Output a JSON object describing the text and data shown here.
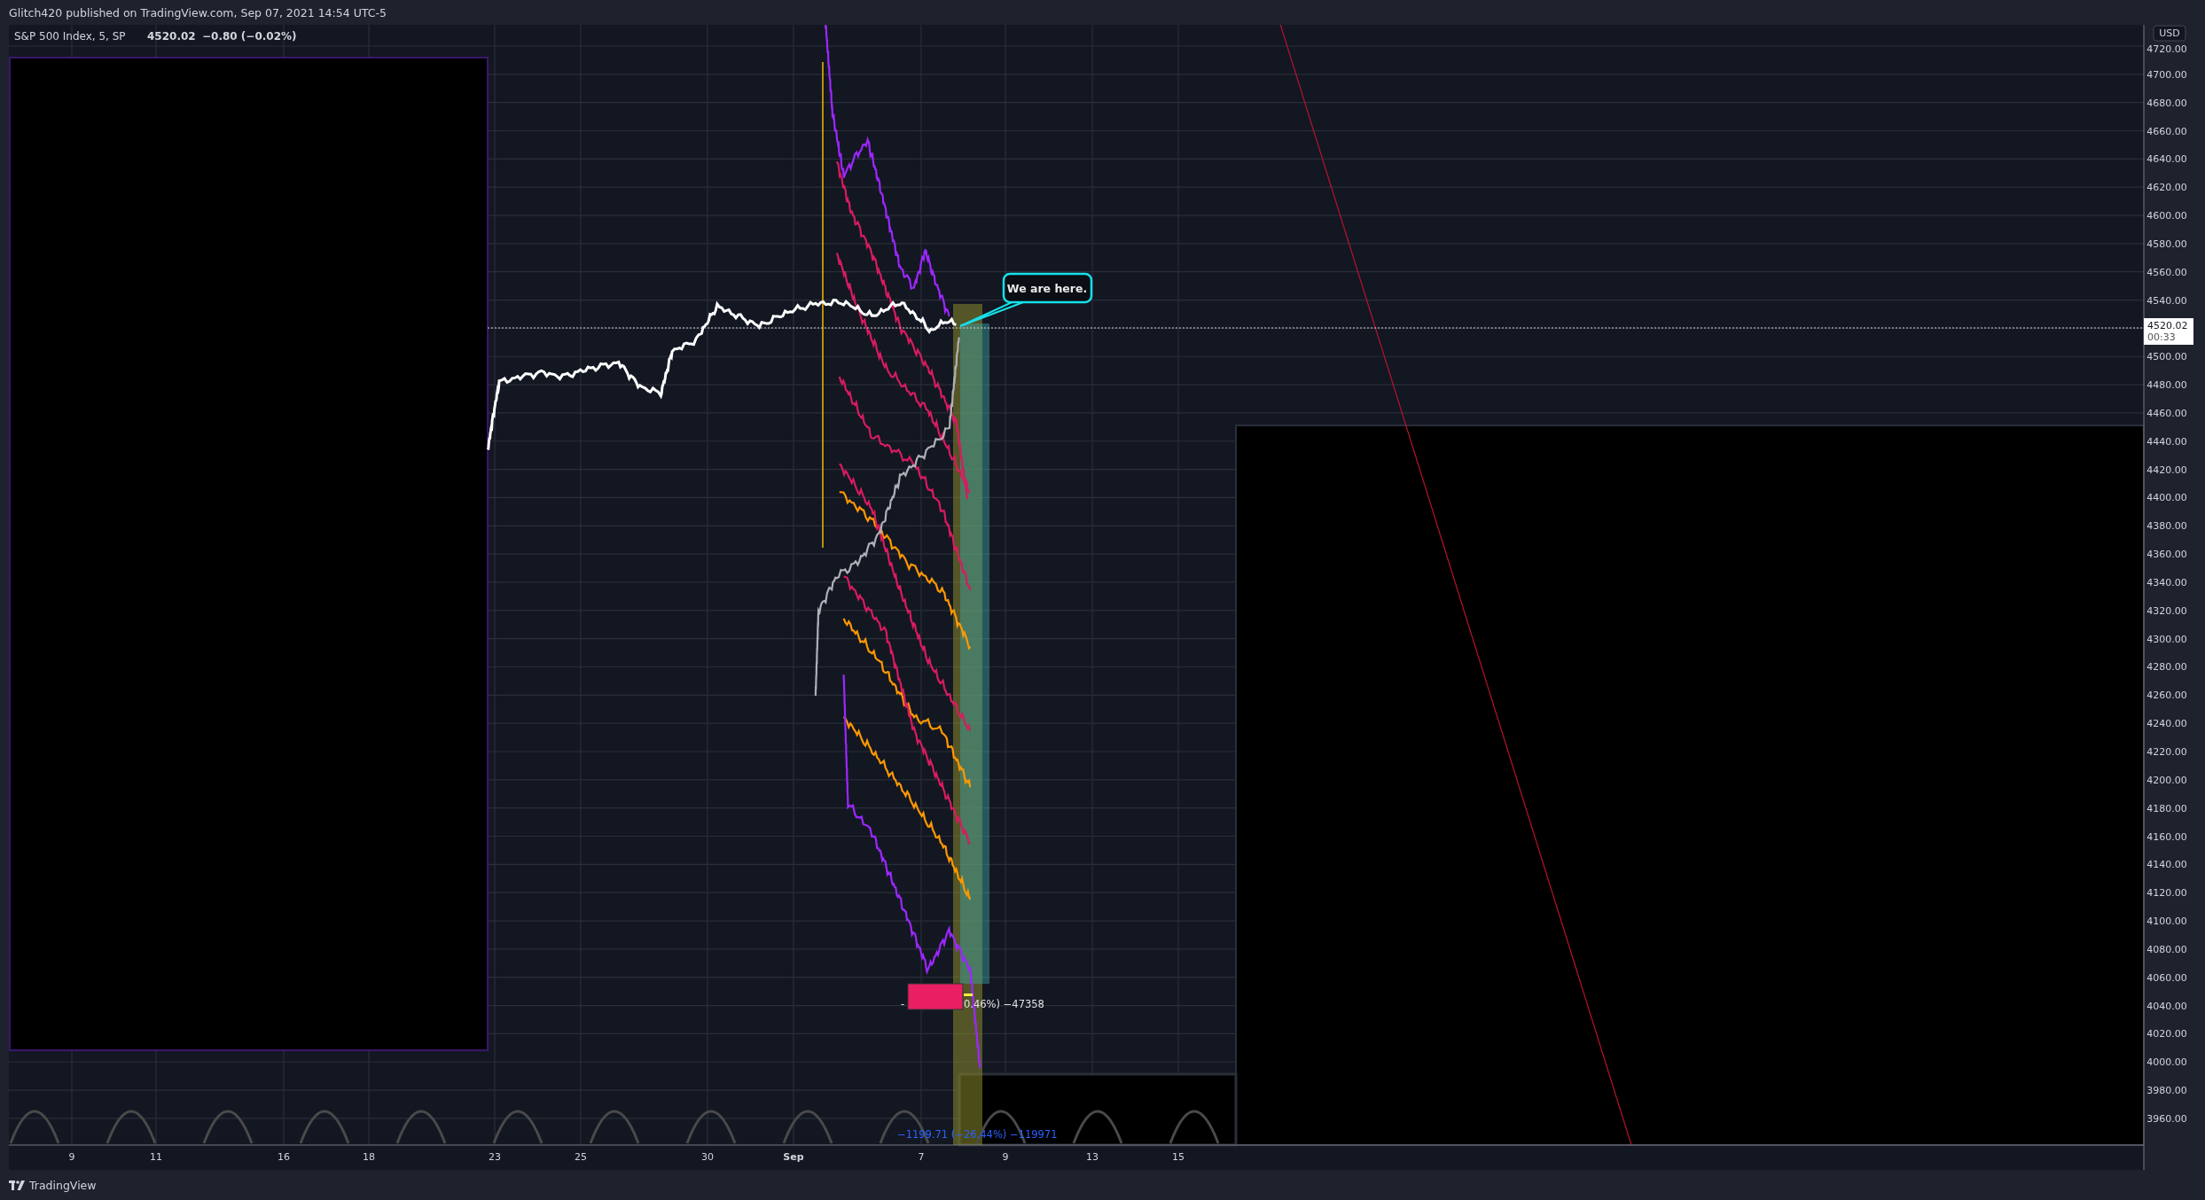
{
  "header": {
    "text": "Glitch420 published on TradingView.com, Sep 07, 2021 14:54 UTC-5"
  },
  "legend": {
    "symbol": "S&P 500 Index, 5, SP",
    "price": "4520.02",
    "change": "−0.80 (−0.02%)"
  },
  "price_axis": {
    "currency": "USD",
    "current_price": "4520.02",
    "countdown": "00:33",
    "labels": [
      "4720.00",
      "4700.00",
      "4680.00",
      "4660.00",
      "4640.00",
      "4620.00",
      "4600.00",
      "4580.00",
      "4560.00",
      "4540.00",
      "4500.00",
      "4480.00",
      "4460.00",
      "4440.00",
      "4420.00",
      "4400.00",
      "4380.00",
      "4360.00",
      "4340.00",
      "4320.00",
      "4300.00",
      "4280.00",
      "4260.00",
      "4240.00",
      "4220.00",
      "4200.00",
      "4180.00",
      "4160.00",
      "4140.00",
      "4120.00",
      "4100.00",
      "4080.00",
      "4060.00",
      "4040.00",
      "4020.00",
      "4000.00",
      "3980.00",
      "3960.00"
    ]
  },
  "time_axis": {
    "labels": [
      {
        "text": "9",
        "kind": "day"
      },
      {
        "text": "11",
        "kind": "day"
      },
      {
        "text": "16",
        "kind": "day"
      },
      {
        "text": "18",
        "kind": "day"
      },
      {
        "text": "23",
        "kind": "day"
      },
      {
        "text": "25",
        "kind": "day"
      },
      {
        "text": "30",
        "kind": "day"
      },
      {
        "text": "Sep",
        "kind": "month"
      },
      {
        "text": "7",
        "kind": "day"
      },
      {
        "text": "9",
        "kind": "day"
      },
      {
        "text": "13",
        "kind": "day"
      },
      {
        "text": "15",
        "kind": "day"
      }
    ]
  },
  "callout": {
    "text": "We are here."
  },
  "measure_label": {
    "left": "-",
    "right": "0.46%) −47358"
  },
  "range_label": {
    "text": "−1199.71 (−26.44%) −119971"
  },
  "footer": {
    "brand": "TradingView"
  }
}
